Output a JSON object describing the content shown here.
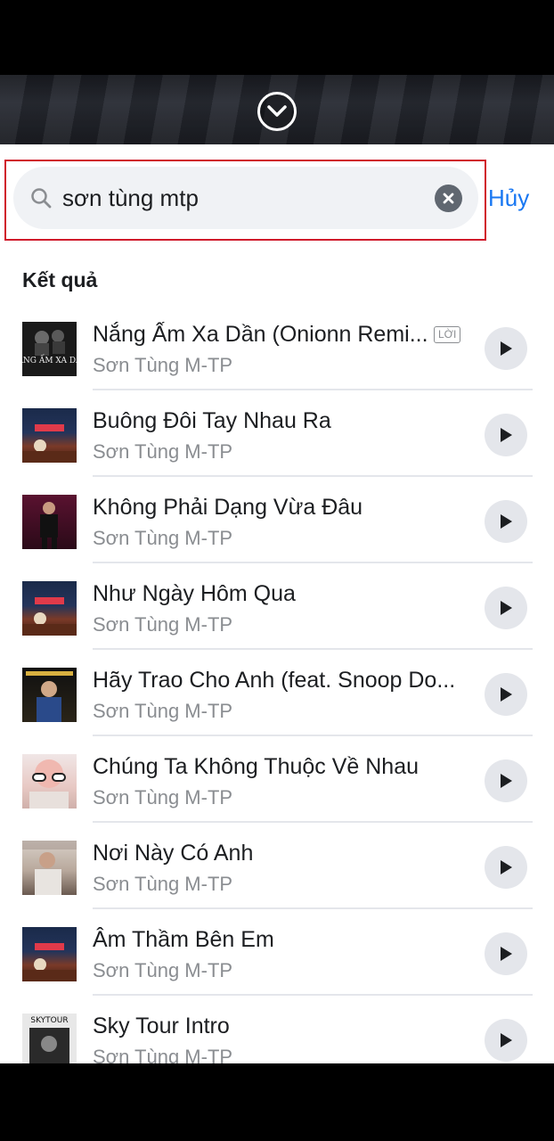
{
  "header": {
    "collapse_icon": "chevron-down-icon"
  },
  "search": {
    "query": "sơn tùng mtp",
    "cancel_label": "Hủy",
    "search_icon": "search-icon",
    "clear_icon": "clear-icon"
  },
  "results": {
    "heading": "Kết quả",
    "items": [
      {
        "title": "Nắng Ấm Xa Dần (Onionn Remi...",
        "artist": "Sơn Tùng M-TP",
        "badge": "LỜI",
        "thumb_text": "NẮNG ẤM XA DẦN"
      },
      {
        "title": "Buông Đôi Tay Nhau Ra",
        "artist": "Sơn Tùng M-TP"
      },
      {
        "title": "Không Phải Dạng Vừa Đâu",
        "artist": "Sơn Tùng M-TP"
      },
      {
        "title": "Như Ngày Hôm Qua",
        "artist": "Sơn Tùng M-TP"
      },
      {
        "title": "Hãy Trao Cho Anh (feat. Snoop Do...",
        "artist": "Sơn Tùng M-TP"
      },
      {
        "title": "Chúng Ta Không Thuộc Về Nhau",
        "artist": "Sơn Tùng M-TP"
      },
      {
        "title": "Nơi Này Có Anh",
        "artist": "Sơn Tùng M-TP"
      },
      {
        "title": "Âm Thầm Bên Em",
        "artist": "Sơn Tùng M-TP"
      },
      {
        "title": "Sky Tour Intro",
        "artist": "Sơn Tùng M-TP",
        "thumb_text": "SKYTOUR"
      }
    ]
  },
  "colors": {
    "accent": "#1877f2",
    "highlight": "#d0192b",
    "text_primary": "#1c1e21",
    "text_secondary": "#8a8d91"
  }
}
